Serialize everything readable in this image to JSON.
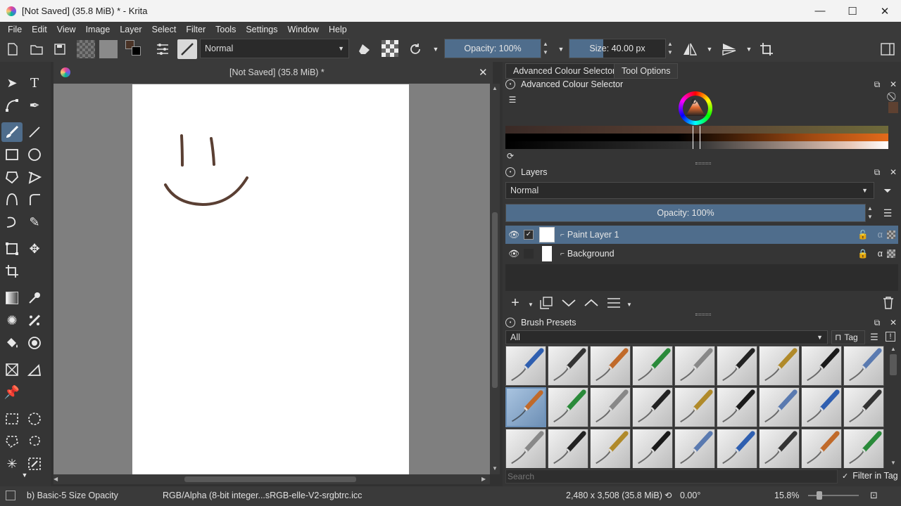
{
  "window": {
    "title": "[Not Saved]  (35.8 MiB) * - Krita",
    "minimize_glyph": "—",
    "maximize_glyph": "☐",
    "close_glyph": "✕"
  },
  "menu": [
    "File",
    "Edit",
    "View",
    "Image",
    "Layer",
    "Select",
    "Filter",
    "Tools",
    "Settings",
    "Window",
    "Help"
  ],
  "toolbar": {
    "blend_mode": "Normal",
    "opacity_label": "Opacity: 100%",
    "opacity_value": 100,
    "size_label": "Size: 40.00 px",
    "size_fill_fraction": 0.35,
    "foreground_color": "#4a3326",
    "background_color": "#000000"
  },
  "document": {
    "tab_title": "[Not Saved]  (35.8 MiB) *",
    "close_glyph": "✕",
    "stroke_color": "#5a3f33"
  },
  "docker_tabs": [
    "Advanced Colour Selector",
    "Tool Options"
  ],
  "colour_selector": {
    "title": "Advanced Colour Selector",
    "current_color": "#5e4131"
  },
  "layers": {
    "title": "Layers",
    "blend_mode": "Normal",
    "opacity_label": "Opacity:  100%",
    "items": [
      {
        "name": "Paint Layer 1",
        "selected": true
      },
      {
        "name": "Background",
        "selected": false
      }
    ]
  },
  "brush_presets": {
    "title": "Brush Presets",
    "filter": "All",
    "tag_label": "Tag",
    "search_placeholder": "Search",
    "filter_in_tag_label": "Filter in Tag"
  },
  "status": {
    "brush_name": "b) Basic-5 Size Opacity",
    "color_profile": "RGB/Alpha (8-bit integer...sRGB-elle-V2-srgbtrc.icc",
    "image_size": "2,480 x 3,508 (35.8 MiB)",
    "rotation": "0.00°",
    "zoom": "15.8%"
  }
}
